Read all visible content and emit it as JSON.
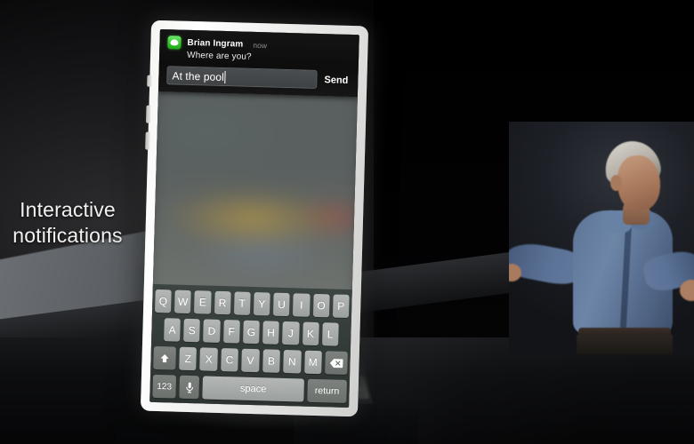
{
  "scene": {
    "caption_line1": "Interactive",
    "caption_line2": "notifications"
  },
  "notification": {
    "app_icon": "messages-icon",
    "sender": "Brian Ingram",
    "time": "now",
    "message": "Where are you?",
    "reply_value": "At the pool",
    "reply_placeholder": "",
    "send_label": "Send"
  },
  "keyboard": {
    "row1": [
      "Q",
      "W",
      "E",
      "R",
      "T",
      "Y",
      "U",
      "I",
      "O",
      "P"
    ],
    "row2": [
      "A",
      "S",
      "D",
      "F",
      "G",
      "H",
      "J",
      "K",
      "L"
    ],
    "row3": [
      "Z",
      "X",
      "C",
      "V",
      "B",
      "N",
      "M"
    ],
    "shift_icon": "shift-icon",
    "backspace_icon": "backspace-icon",
    "numeric_label": "123",
    "mic_icon": "microphone-icon",
    "space_label": "space",
    "return_label": "return"
  },
  "presenter": {
    "label": "presenter-video"
  },
  "colors": {
    "accent_green": "#34c728",
    "key_face": "#b4b7b6",
    "key_dark": "#7d827f",
    "keyboard_bg": "#333b39",
    "banner_bg": "#0d0d0d",
    "shirt_blue": "#6d86a8"
  }
}
